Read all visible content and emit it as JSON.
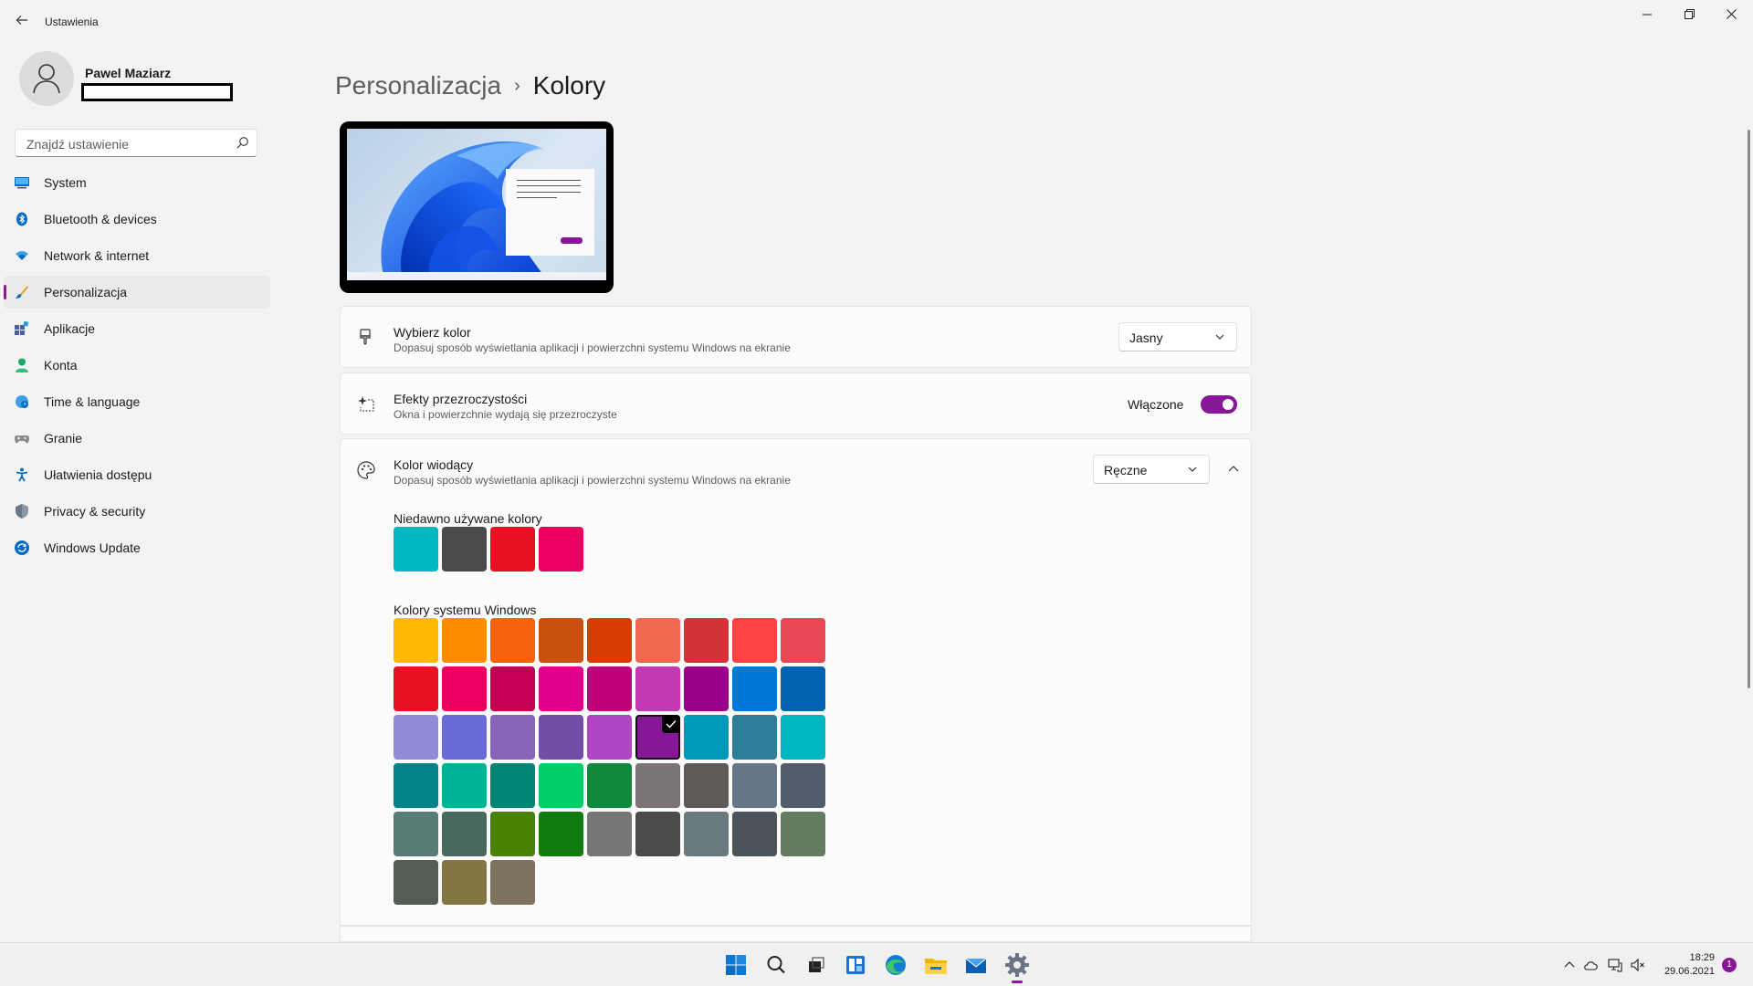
{
  "window": {
    "title": "Ustawienia"
  },
  "profile": {
    "name": "Pawel Maziarz"
  },
  "search": {
    "placeholder": "Znajdź ustawienie"
  },
  "nav": [
    {
      "label": "System",
      "icon": "monitor-icon",
      "active": false
    },
    {
      "label": "Bluetooth & devices",
      "icon": "bluetooth-icon",
      "active": false
    },
    {
      "label": "Network & internet",
      "icon": "wifi-icon",
      "active": false
    },
    {
      "label": "Personalizacja",
      "icon": "brush-icon",
      "active": true
    },
    {
      "label": "Aplikacje",
      "icon": "apps-icon",
      "active": false
    },
    {
      "label": "Konta",
      "icon": "person-icon",
      "active": false
    },
    {
      "label": "Time & language",
      "icon": "globe-clock-icon",
      "active": false
    },
    {
      "label": "Granie",
      "icon": "gamepad-icon",
      "active": false
    },
    {
      "label": "Ułatwienia dostępu",
      "icon": "accessibility-icon",
      "active": false
    },
    {
      "label": "Privacy & security",
      "icon": "shield-icon",
      "active": false
    },
    {
      "label": "Windows Update",
      "icon": "update-icon",
      "active": false
    }
  ],
  "breadcrumb": {
    "parent": "Personalizacja",
    "separator": "›",
    "current": "Kolory"
  },
  "choose_color": {
    "title": "Wybierz kolor",
    "desc": "Dopasuj sposób wyświetlania aplikacji i powierzchni systemu Windows na ekranie",
    "value": "Jasny"
  },
  "transparency": {
    "title": "Efekty przezroczystości",
    "desc": "Okna i powierzchnie wydają się przezroczyste",
    "state_label": "Włączone",
    "on": true
  },
  "accent": {
    "title": "Kolor wiodący",
    "desc": "Dopasuj sposób wyświetlania aplikacji i powierzchni systemu Windows na ekranie",
    "value": "Ręczne",
    "recent_label": "Niedawno używane kolory",
    "windows_label": "Kolory systemu Windows",
    "recent_colors": [
      "#00b7c3",
      "#4c4a48",
      "#e81123",
      "#ea005e"
    ],
    "windows_colors": [
      [
        "#ffb900",
        "#ff8c00",
        "#f7630c",
        "#ca5010",
        "#da3b01",
        "#ef6950",
        "#d13438",
        "#ff4343",
        "#e74856"
      ],
      [
        "#e81123",
        "#ea005e",
        "#c30052",
        "#e3008c",
        "#bf0077",
        "#c239b3",
        "#9a0089",
        "#0078d7",
        "#0063b1"
      ],
      [
        "#8e8cd8",
        "#6b69d6",
        "#8764b8",
        "#744da9",
        "#b146c2",
        "#881798",
        "#0099bc",
        "#2d7d9a",
        "#00b7c3"
      ],
      [
        "#038387",
        "#00b294",
        "#018574",
        "#00cc6a",
        "#10893e",
        "#7a7574",
        "#5d5a58",
        "#68768a",
        "#515c6b"
      ],
      [
        "#567c73",
        "#486860",
        "#498205",
        "#107c10",
        "#767676",
        "#4c4a48",
        "#69797e",
        "#4a5459",
        "#647c64"
      ],
      [
        "#525e54",
        "#847545",
        "#7e735f"
      ]
    ],
    "selected": "#881798"
  },
  "taskbar": {
    "apps": [
      "windows-start-icon",
      "search-icon",
      "task-view-icon",
      "widgets-icon",
      "edge-icon",
      "file-explorer-icon",
      "mail-icon",
      "settings-gear-icon"
    ],
    "time": "18:29",
    "date": "29.06.2021",
    "notifications": "1"
  }
}
